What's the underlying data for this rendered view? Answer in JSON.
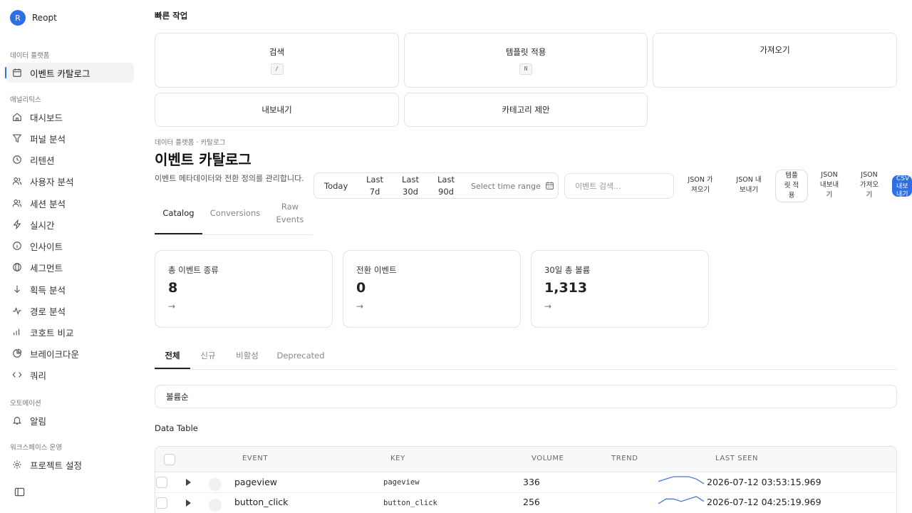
{
  "app": {
    "name": "Reopt",
    "logo_letter": "R",
    "accent": "#2f6fe4"
  },
  "sidebar": {
    "sections": [
      {
        "label": "데이터 플랫폼"
      },
      {
        "label": "애널리틱스"
      },
      {
        "label": "오토메이션"
      },
      {
        "label": "워크스페이스 운영"
      }
    ],
    "items": [
      {
        "label": "이벤트 카탈로그",
        "icon": "calendar-icon",
        "active": true
      },
      {
        "label": "대시보드",
        "icon": "home-icon"
      },
      {
        "label": "퍼널 분석",
        "icon": "funnel-icon"
      },
      {
        "label": "리텐션",
        "icon": "clock-icon"
      },
      {
        "label": "사용자 분석",
        "icon": "users-icon"
      },
      {
        "label": "세션 분석",
        "icon": "users-icon"
      },
      {
        "label": "실시간",
        "icon": "bolt-icon"
      },
      {
        "label": "인사이트",
        "icon": "info-icon"
      },
      {
        "label": "세그먼트",
        "icon": "segment-icon"
      },
      {
        "label": "획득 분석",
        "icon": "arrow-down-icon"
      },
      {
        "label": "경로 분석",
        "icon": "activity-icon"
      },
      {
        "label": "코호트 비교",
        "icon": "bar-chart-icon"
      },
      {
        "label": "브레이크다운",
        "icon": "pie-chart-icon"
      },
      {
        "label": "쿼리",
        "icon": "code-icon"
      },
      {
        "label": "알림",
        "icon": "bell-icon"
      },
      {
        "label": "프로젝트 설정",
        "icon": "gear-icon"
      }
    ]
  },
  "quick_actions": {
    "title": "빠른 작업",
    "cards": [
      {
        "label": "검색",
        "shortcut": "/"
      },
      {
        "label": "템플릿 적용",
        "shortcut": "N"
      },
      {
        "label": "가져오기"
      },
      {
        "label": "내보내기"
      },
      {
        "label": "카테고리 제안"
      }
    ]
  },
  "header": {
    "breadcrumb": "데이터 플랫폼 · 카탈로그",
    "title": "이벤트 카탈로그",
    "description": "이벤트 메타데이터와 전환 정의를 관리합니다."
  },
  "time_range": {
    "options": [
      "Today",
      "Last\n7d",
      "Last\n30d",
      "Last\n90d"
    ],
    "select_placeholder": "Select time range"
  },
  "search": {
    "placeholder": "이벤트 검색..."
  },
  "toolbar": {
    "buttons": [
      "JSON 가\n져오기",
      "JSON 내\n보내기",
      "템플\n릿 적\n용",
      "JSON\n내보내\n기",
      "JSON\n가져오\n기",
      "CSV\n내보\n내기"
    ]
  },
  "main_tabs": [
    "Catalog",
    "Conversions",
    "Raw\nEvents"
  ],
  "stats": [
    {
      "label": "총 이벤트 종류",
      "value": "8",
      "arrow": "→"
    },
    {
      "label": "전환 이벤트",
      "value": "0",
      "arrow": "→"
    },
    {
      "label": "30일 총 볼륨",
      "value": "1,313",
      "arrow": "→"
    }
  ],
  "filter_tabs": [
    "전체",
    "신규",
    "비활성",
    "Deprecated"
  ],
  "sort": {
    "value": "볼륨순"
  },
  "table": {
    "title": "Data Table",
    "columns": [
      "EVENT",
      "KEY",
      "VOLUME",
      "TREND",
      "LAST SEEN"
    ],
    "rows": [
      {
        "event": "pageview",
        "key": "pageview",
        "volume": "336",
        "last_seen": "2026-07-12 03:53:15.969",
        "trend": [
          3,
          4,
          5,
          5,
          5,
          4,
          2
        ]
      },
      {
        "event": "button_click",
        "key": "button_click",
        "volume": "256",
        "last_seen": "2026-07-12 04:25:19.969",
        "trend": [
          2,
          4,
          4,
          3,
          4,
          5,
          3
        ]
      }
    ]
  }
}
